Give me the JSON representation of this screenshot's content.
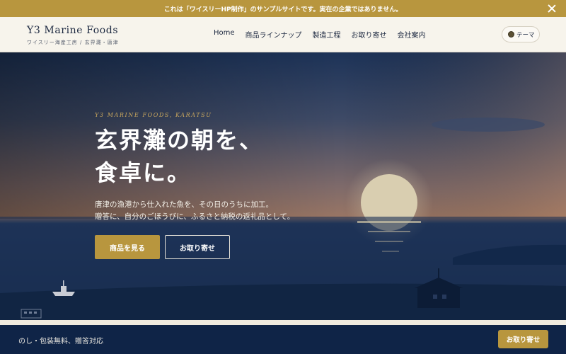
{
  "notice": {
    "text": "これは「ワイスリーHP制作」のサンプルサイトです。実在の企業ではありません。",
    "close_icon": "close-icon"
  },
  "header": {
    "brand_name": "Y3 Marine Foods",
    "brand_sub": "ワイスリー海産工房 / 玄界灘・唐津",
    "nav": [
      "Home",
      "商品ラインナップ",
      "製造工程",
      "お取り寄せ",
      "会社案内"
    ],
    "theme_label": "テーマ"
  },
  "hero": {
    "eyebrow": "Y3 MARINE FOODS, KARATSU",
    "headline": [
      "玄界灘の朝を、",
      "食卓に。"
    ],
    "lead": [
      "唐津の漁港から仕入れた魚を、その日のうちに加工。",
      "贈答に、自分のごほうびに、ふるさと納税の返礼品として。"
    ],
    "primary_cta": "商品を見る",
    "secondary_cta": "お取り寄せ"
  },
  "bottom_bar": {
    "text": "のし・包装無料、贈答対応",
    "button": "お取り寄せ"
  },
  "colors": {
    "accent": "#b8963e",
    "navy": "#0f2447",
    "header_bg": "#f7f4ec"
  }
}
